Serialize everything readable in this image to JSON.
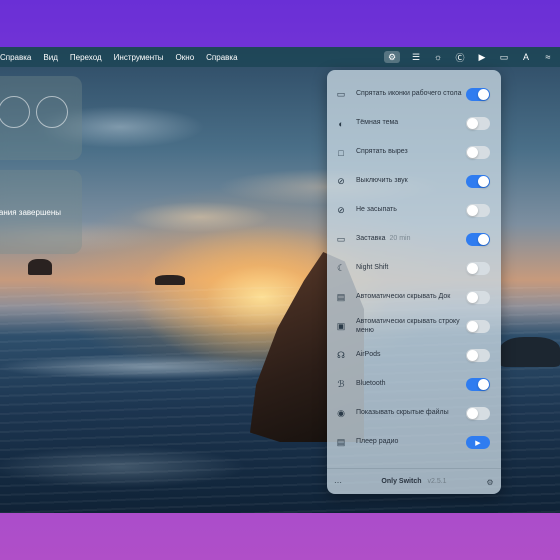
{
  "menubar": {
    "items": [
      "Справка",
      "Вид",
      "Переход",
      "Инструменты",
      "Окно",
      "Справка"
    ],
    "right_icons": [
      "switch-icon",
      "layers-icon",
      "brightness-icon",
      "c-circle-icon",
      "play-circle-icon",
      "screen-icon",
      "a-box-icon",
      "wifi-icon"
    ]
  },
  "widgets": {
    "bottom_text": "инания завершены"
  },
  "panel": {
    "rows": [
      {
        "icon": "display-icon",
        "label": "Спрятать иконки рабочего стола",
        "note": "",
        "control": "toggle",
        "on": true
      },
      {
        "icon": "half-circle-icon",
        "label": "Тёмная тема",
        "note": "",
        "control": "toggle",
        "on": false
      },
      {
        "icon": "notch-icon",
        "label": "Спрятать вырез",
        "note": "",
        "control": "toggle",
        "on": false
      },
      {
        "icon": "mute-icon",
        "label": "Выключить звук",
        "note": "",
        "control": "toggle",
        "on": true
      },
      {
        "icon": "no-sleep-icon",
        "label": "Не засыпать",
        "note": "",
        "control": "toggle",
        "on": false
      },
      {
        "icon": "screensaver-icon",
        "label": "Заставка",
        "note": "20 min",
        "control": "toggle",
        "on": true
      },
      {
        "icon": "moon-icon",
        "label": "Night Shift",
        "note": "",
        "control": "toggle",
        "on": false
      },
      {
        "icon": "dock-icon",
        "label": "Автоматически скрывать Док",
        "note": "",
        "control": "toggle",
        "on": false
      },
      {
        "icon": "menubar-icon",
        "label": "Автоматически скрывать строку меню",
        "note": "",
        "control": "toggle",
        "on": false
      },
      {
        "icon": "airpods-icon",
        "label": "AirPods",
        "note": "",
        "control": "toggle",
        "on": false
      },
      {
        "icon": "bluetooth-icon",
        "label": "Bluetooth",
        "note": "",
        "control": "toggle",
        "on": true
      },
      {
        "icon": "eye-icon",
        "label": "Показывать скрытые файлы",
        "note": "",
        "control": "toggle",
        "on": false
      },
      {
        "icon": "radio-icon",
        "label": "Плеер радио",
        "note": "",
        "control": "play",
        "on": true
      }
    ],
    "footer": {
      "app_name": "Only Switch",
      "version": "v2.5.1",
      "left_icon": "more-icon",
      "right_icon": "settings-icon"
    }
  }
}
